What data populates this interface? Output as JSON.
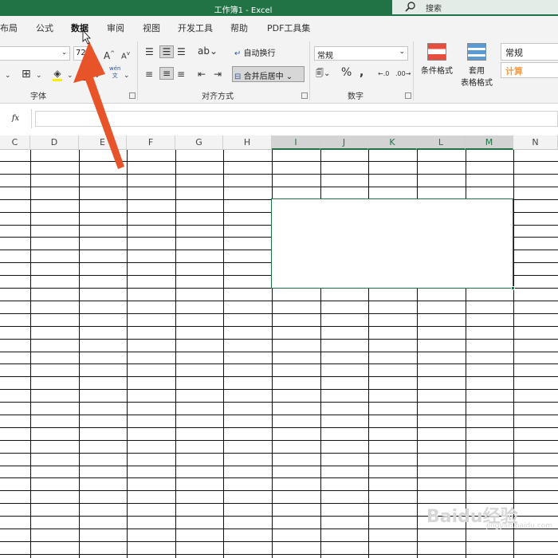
{
  "window": {
    "title": "工作簿1  -  Excel",
    "search_placeholder": "搜索"
  },
  "menu": {
    "tabs": [
      "布局",
      "公式",
      "数据",
      "审阅",
      "视图",
      "开发工具",
      "帮助",
      "PDF工具集"
    ],
    "active_tab": "数据"
  },
  "ribbon": {
    "font_size": "72",
    "wrap_text": "自动换行",
    "merge_center": "合并后居中",
    "number_format": "常规",
    "conditional_format": "条件格式",
    "table_format_line1": "套用",
    "table_format_line2": "表格格式",
    "style_normal": "常规",
    "style_calc": "计算",
    "group_font": "字体",
    "group_align": "对齐方式",
    "group_number": "数字",
    "phonetic_icon_text": "wén",
    "phonetic_icon_sub": "文",
    "fx": "fx"
  },
  "columns": [
    "C",
    "D",
    "E",
    "F",
    "G",
    "H",
    "I",
    "J",
    "K",
    "L",
    "M",
    "N"
  ],
  "selected_columns": [
    "I",
    "J",
    "K",
    "L",
    "M"
  ],
  "formula_bar": {
    "value": ""
  },
  "watermark": {
    "text": "Baidu经验",
    "sub": "jingyan.baidu.com"
  },
  "colors": {
    "excel_green": "#217346",
    "arrow": "#e8542a",
    "calc_orange": "#f0a04b"
  }
}
